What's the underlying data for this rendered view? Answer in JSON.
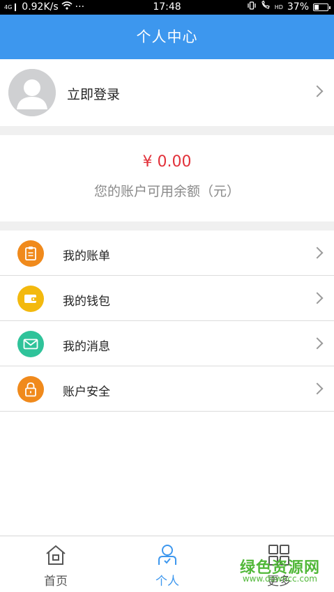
{
  "status_bar": {
    "network_type": "4G",
    "speed": "0.92K/s",
    "more": "···",
    "time": "17:48",
    "hd_label": "HD",
    "battery": "37%",
    "battery_level": 0.37
  },
  "header": {
    "title": "个人中心"
  },
  "login": {
    "label": "立即登录"
  },
  "balance": {
    "amount": "¥ 0.00",
    "caption": "您的账户可用余额（元）"
  },
  "menu": {
    "items": [
      {
        "label": "我的账单",
        "icon": "bill-icon",
        "color": "#f08a1c"
      },
      {
        "label": "我的钱包",
        "icon": "wallet-icon",
        "color": "#f3b90e"
      },
      {
        "label": "我的消息",
        "icon": "mail-icon",
        "color": "#2fc39a"
      },
      {
        "label": "账户安全",
        "icon": "lock-icon",
        "color": "#f08a1c"
      }
    ]
  },
  "tabs": {
    "items": [
      {
        "label": "首页",
        "icon": "home-icon",
        "color": "#555555"
      },
      {
        "label": "个人",
        "icon": "person-icon",
        "color": "#3d97ee"
      },
      {
        "label": "更多",
        "icon": "grid-icon",
        "color": "#555555"
      }
    ]
  },
  "watermark": {
    "text": "绿色资源网",
    "sub": "www.downcc.com"
  },
  "colors": {
    "brand_blue": "#3d97ee",
    "amount_red": "#e2313a"
  }
}
